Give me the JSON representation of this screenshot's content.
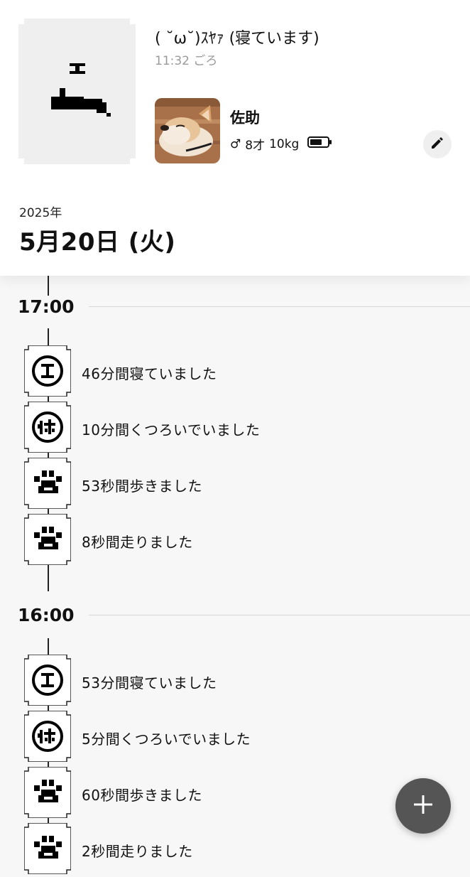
{
  "status": {
    "text": "( ˘ω˘)ｽﾔｧ (寝ています)",
    "time": "11:32 ごろ"
  },
  "pet": {
    "name": "佐助",
    "gender_symbol": "♂",
    "age": "8才",
    "weight": "10kg",
    "battery_level": 0.7
  },
  "date": {
    "year": "2025年",
    "day": "5月20日 (火)"
  },
  "timeline": [
    {
      "hour": "17:00",
      "entries": [
        {
          "type": "sleep",
          "text": "46分間寝ていました"
        },
        {
          "type": "rest",
          "text": "10分間くつろいでいました"
        },
        {
          "type": "walk",
          "text": "53秒間歩きました"
        },
        {
          "type": "run",
          "text": "8秒間走りました"
        }
      ]
    },
    {
      "hour": "16:00",
      "entries": [
        {
          "type": "sleep",
          "text": "53分間寝ていました"
        },
        {
          "type": "rest",
          "text": "5分間くつろいでいました"
        },
        {
          "type": "walk",
          "text": "60秒間歩きました"
        },
        {
          "type": "run",
          "text": "2秒間走りました"
        }
      ]
    }
  ],
  "icons": {
    "edit": "pencil-icon",
    "add": "plus-icon",
    "sleep": "sleep-icon",
    "rest": "rest-icon",
    "walk": "paw-icon",
    "run": "paw-icon"
  },
  "colors": {
    "fab": "#555555",
    "header_bg": "#ffffff",
    "page_bg": "#f7f7f7",
    "secondary_text": "#9a9a9a"
  }
}
